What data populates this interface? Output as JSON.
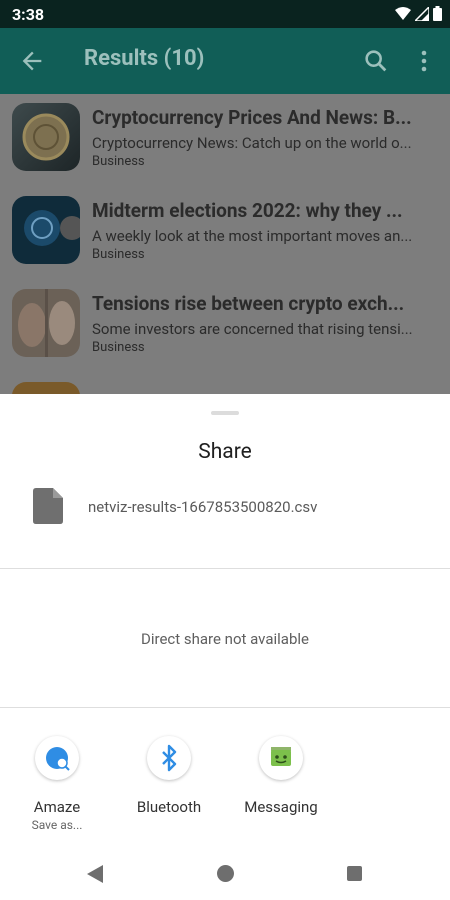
{
  "status_bar": {
    "time": "3:38"
  },
  "app_bar": {
    "title": "Results (10)"
  },
  "results": [
    {
      "title": "Cryptocurrency Prices And News: B...",
      "description": "Cryptocurrency News: Catch up on the world o...",
      "category": "Business"
    },
    {
      "title": "Midterm elections 2022: why they ...",
      "description": "A weekly look at the most important moves an...",
      "category": "Business"
    },
    {
      "title": "Tensions rise between crypto exch...",
      "description": "Some investors are concerned that rising tensi...",
      "category": "Business"
    }
  ],
  "share_sheet": {
    "title": "Share",
    "file_name": "netviz-results-1667853500820.csv",
    "direct_share_message": "Direct share not available",
    "apps": [
      {
        "label": "Amaze",
        "sublabel": "Save as...",
        "icon": "amaze-icon",
        "color": "#2f8de4"
      },
      {
        "label": "Bluetooth",
        "sublabel": "",
        "icon": "bluetooth-icon",
        "color": "#2f8de4"
      },
      {
        "label": "Messaging",
        "sublabel": "",
        "icon": "messaging-icon",
        "color": "#7cc04b"
      }
    ]
  },
  "colors": {
    "app_bar": "#115e57",
    "status_bar": "#0a231f",
    "scrim_list": "#7d7d7d"
  }
}
